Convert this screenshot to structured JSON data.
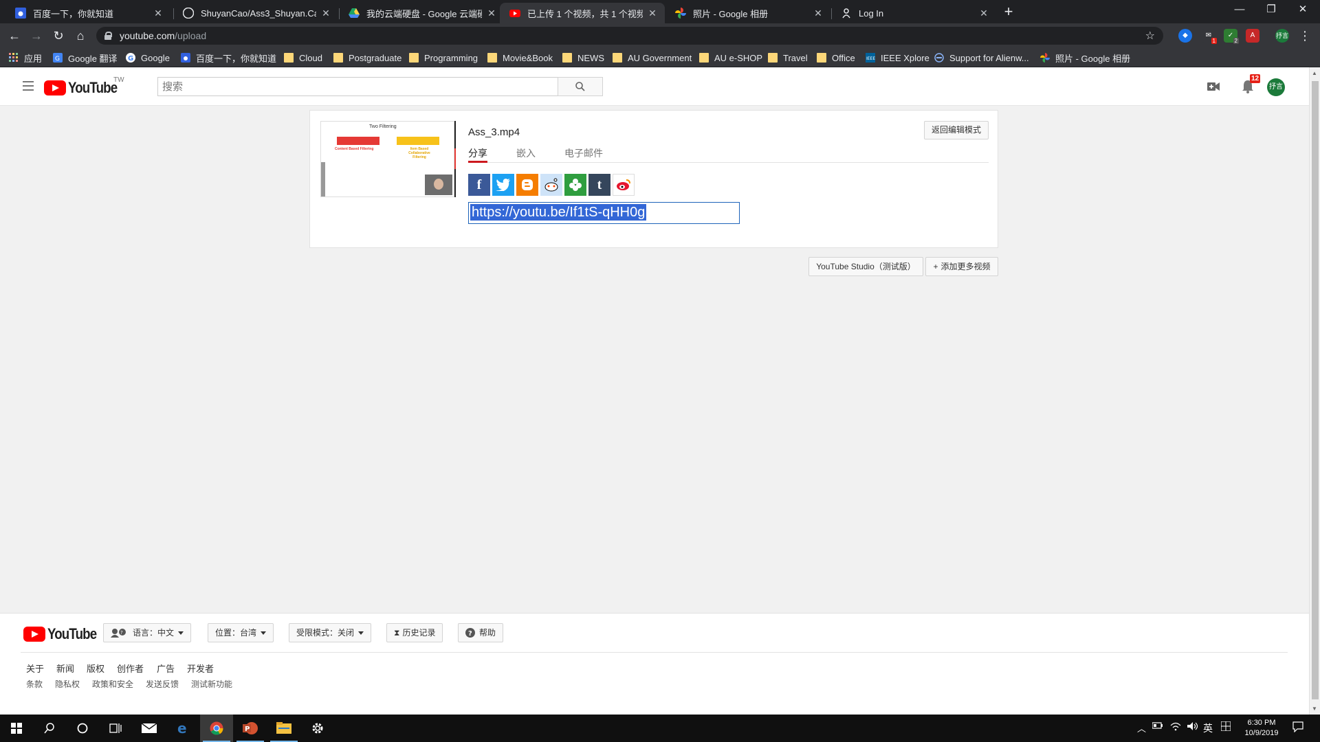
{
  "browser": {
    "tabs": [
      {
        "title": "百度一下，你就知道",
        "icon": "baidu-icon"
      },
      {
        "title": "ShuyanCao/Ass3_Shuyan.Cao_13",
        "icon": "github-icon"
      },
      {
        "title": "我的云端硬盘 - Google 云端硬盘",
        "icon": "google-drive-icon"
      },
      {
        "title": "已上传 1 个视频，共 1 个视频 - Y",
        "icon": "youtube-icon",
        "active": true
      },
      {
        "title": "照片 - Google 相册",
        "icon": "google-photos-icon"
      },
      {
        "title": "Log In",
        "icon": "login-icon"
      }
    ],
    "url_host": "youtube.com",
    "url_path": "/upload",
    "bookmarks": [
      {
        "label": "应用",
        "icon": "apps-grid-icon"
      },
      {
        "label": "Google 翻译",
        "icon": "google-translate-icon"
      },
      {
        "label": "Google",
        "icon": "google-icon"
      },
      {
        "label": "百度一下，你就知道",
        "icon": "baidu-icon"
      },
      {
        "label": "Cloud",
        "icon": "folder-icon"
      },
      {
        "label": "Postgraduate",
        "icon": "folder-icon"
      },
      {
        "label": "Programming",
        "icon": "folder-icon"
      },
      {
        "label": "Movie&Book",
        "icon": "folder-icon"
      },
      {
        "label": "NEWS",
        "icon": "folder-icon"
      },
      {
        "label": "AU Government",
        "icon": "folder-icon"
      },
      {
        "label": "AU e-SHOP",
        "icon": "folder-icon"
      },
      {
        "label": "Travel",
        "icon": "folder-icon"
      },
      {
        "label": "Office",
        "icon": "folder-icon"
      },
      {
        "label": "IEEE Xplore",
        "icon": "ieee-icon"
      },
      {
        "label": "Support for Alienw...",
        "icon": "dell-icon"
      },
      {
        "label": "照片 - Google 相册",
        "icon": "google-photos-icon"
      }
    ],
    "extension_badges": {
      "ext1": "1",
      "ext2": "2"
    },
    "profile_label": "抒言"
  },
  "youtube": {
    "region": "TW",
    "search_placeholder": "搜索",
    "notification_count": "12",
    "avatar_label": "抒言",
    "upload": {
      "filename": "Ass_3.mp4",
      "back_button": "返回编辑模式",
      "tabs": [
        "分享",
        "嵌入",
        "电子邮件"
      ],
      "share_url": "https://youtu.be/If1tS-qHH0g",
      "share_icons": [
        "facebook-icon",
        "twitter-icon",
        "blogger-icon",
        "reddit-icon",
        "cloud-share-icon",
        "tumblr-icon",
        "weibo-icon"
      ],
      "thumbnail": {
        "title": "Two Filtering",
        "left_label": "Content Based Filtering",
        "right_label": "Item Based Collaborative Filtering"
      }
    },
    "studio_button": "YouTube Studio（测试版）",
    "add_more_button": "添加更多视频",
    "footer": {
      "language": "语言：中文",
      "location": "位置：台湾",
      "restricted": "受限模式：关闭",
      "history": "历史记录",
      "help": "帮助",
      "links_row1": [
        "关于",
        "新闻",
        "版权",
        "创作者",
        "广告",
        "开发者"
      ],
      "links_row2": [
        "条款",
        "隐私权",
        "政策和安全",
        "发送反馈",
        "测试新功能"
      ]
    }
  },
  "taskbar": {
    "ime": "英",
    "time": "6:30 PM",
    "date": "10/9/2019"
  },
  "colors": {
    "youtube_red": "#ff0000",
    "selection_blue": "#3367d6",
    "chrome_dark": "#202124"
  }
}
